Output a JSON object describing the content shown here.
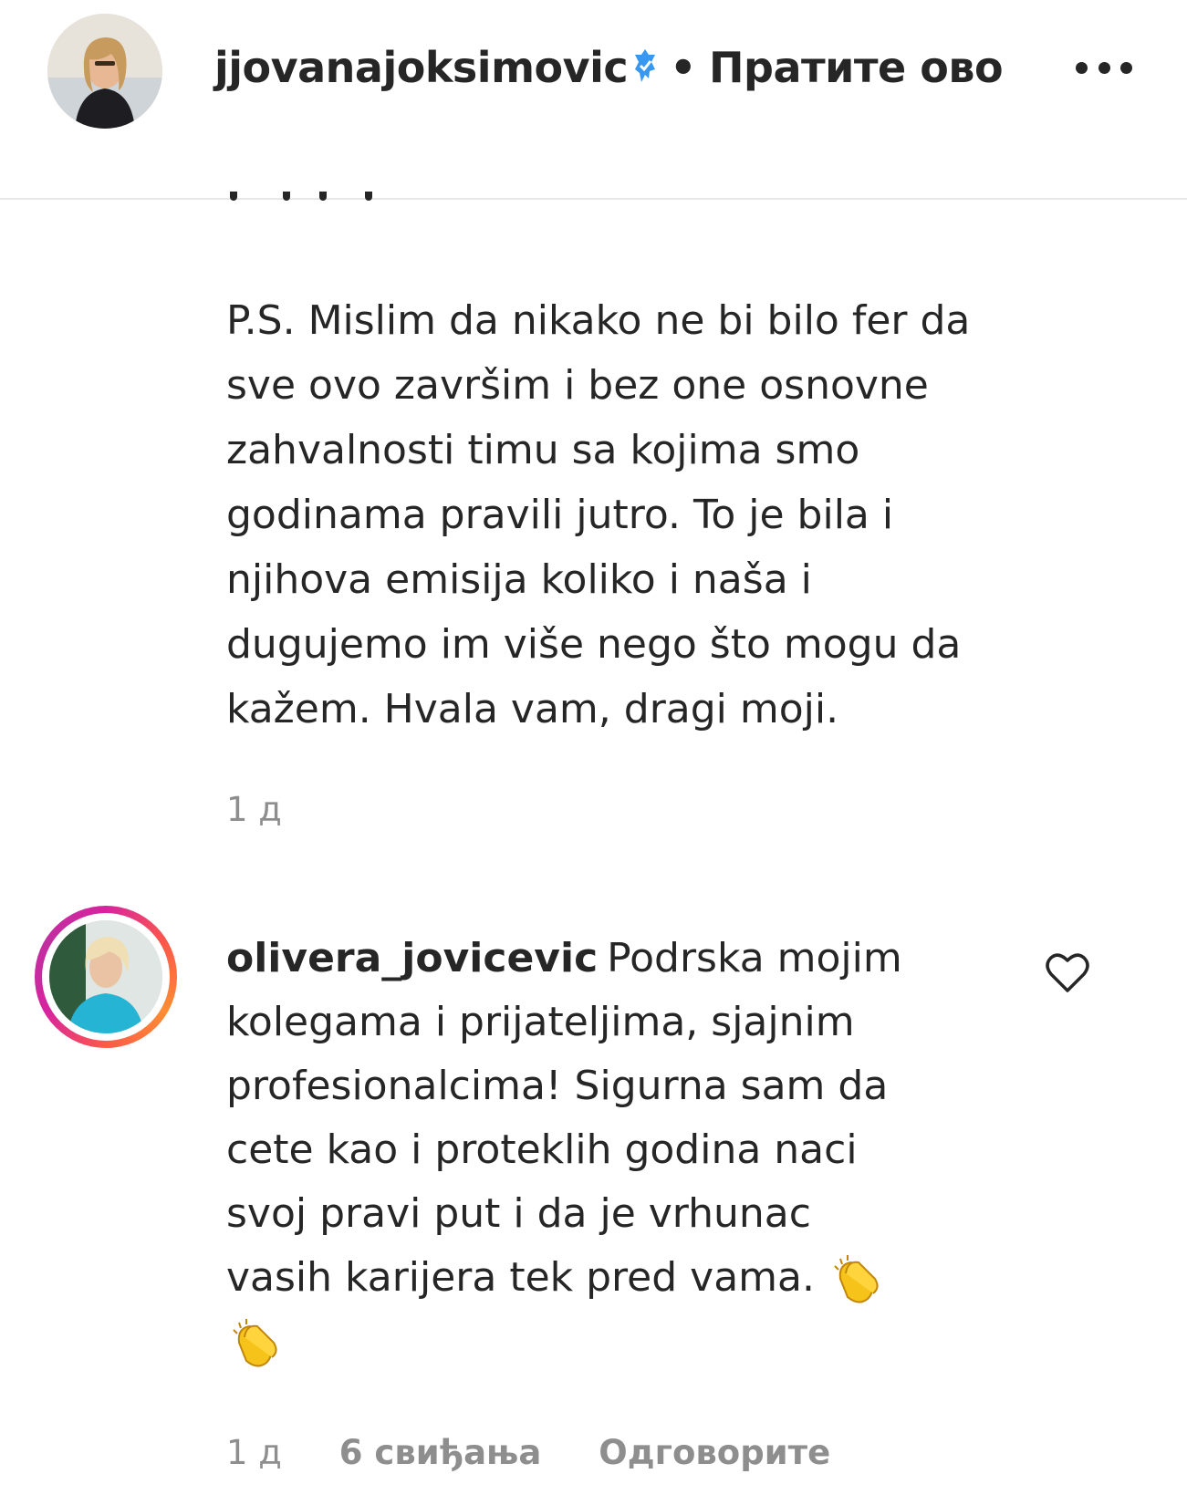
{
  "header": {
    "username": "jjovanajoksimovic",
    "separator": "•",
    "follow_label": "Пратите ово"
  },
  "caption": {
    "lines": [
      "P.S. Mislim da nikako ne bi bilo fer da",
      "sve ovo završim i bez one osnovne",
      "zahvalnosti timu sa kojima smo",
      "godinama pravili jutro. To je bila i",
      "njihova emisija koliko i naša i",
      "dugujemo im više nego što mogu da",
      "kažem. Hvala vam, dragi moji."
    ],
    "time": "1 д"
  },
  "comment": {
    "username": "olivera_jovicevic",
    "lines": [
      "Podrska mojim",
      "kolegama i prijateljima, sjajnim",
      "profesionalcima! Sigurna sam da",
      "cete kao i proteklih godina naci",
      "svoj pravi put i da je vrhunac",
      "vasih karijera tek pred vama."
    ],
    "time": "1 д",
    "likes": "6 свиђања",
    "reply_label": "Одговорите"
  },
  "colors": {
    "text": "#262626",
    "muted": "#8e8e8e",
    "verified": "#3897f0",
    "story_ring": "#d6249f"
  }
}
